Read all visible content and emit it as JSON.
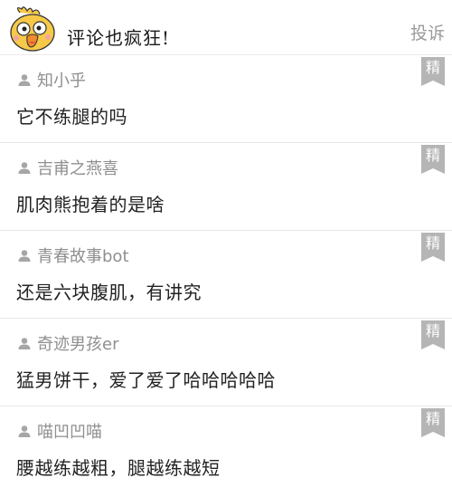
{
  "header": {
    "title": "评论也疯狂!",
    "report_label": "投诉"
  },
  "comments": [
    {
      "user": "知小乎",
      "text": "它不练腿的吗",
      "badge": "精"
    },
    {
      "user": "吉甫之燕喜",
      "text": "肌肉熊抱着的是啥",
      "badge": "精"
    },
    {
      "user": "青春故事bot",
      "text": "还是六块腹肌，有讲究",
      "badge": "精"
    },
    {
      "user": "奇迹男孩er",
      "text": "猛男饼干，爱了爱了哈哈哈哈哈",
      "badge": "精"
    },
    {
      "user": "喵凹凹喵",
      "text": "腰越练越粗，腿越练越短",
      "badge": "精"
    }
  ]
}
